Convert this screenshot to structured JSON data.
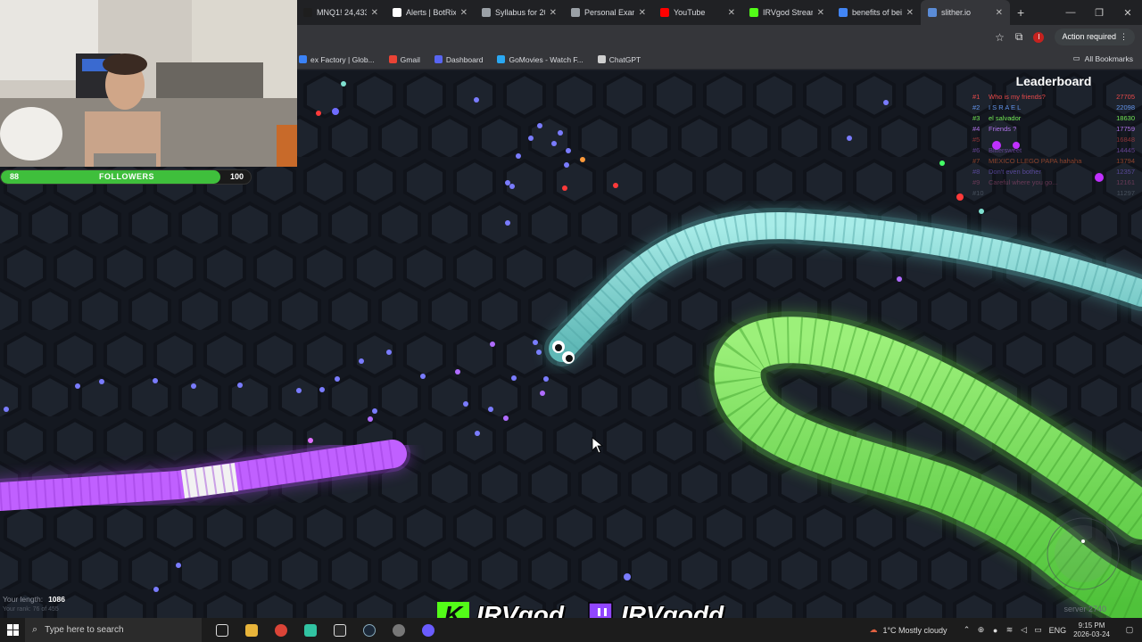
{
  "browser": {
    "tabs": [
      {
        "title": "MNQ1! 24,433",
        "color": "#1e1e1e"
      },
      {
        "title": "Alerts | BotRix",
        "color": "#ffffff"
      },
      {
        "title": "Syllabus for 20",
        "color": "#9aa0a6"
      },
      {
        "title": "Personal Exam",
        "color": "#9aa0a6"
      },
      {
        "title": "YouTube",
        "color": "#ff0000"
      },
      {
        "title": "IRVgod Stream",
        "color": "#53fc18"
      },
      {
        "title": "benefits of bei",
        "color": "#4285f4"
      },
      {
        "title": "slither.io",
        "color": "#5b8cd6",
        "active": true
      }
    ],
    "new_tab": "+",
    "action_required": "Action required",
    "bookmarks": [
      {
        "label": "ex Factory | Glob...",
        "color": "#3b82f6"
      },
      {
        "label": "Gmail",
        "color": "#ea4335"
      },
      {
        "label": "Dashboard",
        "color": "#5865f2"
      },
      {
        "label": "GoMovies - Watch F...",
        "color": "#2aa8f2"
      },
      {
        "label": "ChatGPT",
        "color": "#cfcfcf"
      }
    ],
    "all_bookmarks": "All Bookmarks"
  },
  "overlay": {
    "followers_label": "FOLLOWERS",
    "followers_current": "88",
    "followers_goal": "100",
    "followers_progress": 0.88
  },
  "game": {
    "leaderboard_title": "Leaderboard",
    "leaderboard": [
      {
        "rank": "#1",
        "name": "Who is my friends?",
        "score": "27705",
        "color": "#ff4e4e"
      },
      {
        "rank": "#2",
        "name": "I S R A E L",
        "score": "22098",
        "color": "#6aa0ff"
      },
      {
        "rank": "#3",
        "name": "el salvador",
        "score": "18630",
        "color": "#7dff5c"
      },
      {
        "rank": "#4",
        "name": "Friends ?",
        "score": "17759",
        "color": "#c07dff"
      },
      {
        "rank": "#5",
        "name": "",
        "score": "16848",
        "color": "#ff4e4e"
      },
      {
        "rank": "#6",
        "name": "Bittersweet",
        "score": "14445",
        "color": "#b06cff"
      },
      {
        "rank": "#7",
        "name": "MEXICO LLEGO PAPA hahaha",
        "score": "13794",
        "color": "#ff6e3a"
      },
      {
        "rank": "#8",
        "name": "Don't even bother",
        "score": "12357",
        "color": "#8f6cff"
      },
      {
        "rank": "#9",
        "name": "Careful where you go...",
        "score": "12161",
        "color": "#b0507f"
      },
      {
        "rank": "#10",
        "name": "",
        "score": "11297",
        "color": "#6f7b8a"
      }
    ],
    "your_length_label": "Your length:",
    "your_length": "1086",
    "your_rank": "Your rank: 76 of 455",
    "server": "server 2740"
  },
  "branding": {
    "kick_name": "IRVgod",
    "twitch_name": "IRVgodd"
  },
  "taskbar": {
    "search_placeholder": "Type here to search",
    "weather": "1°C  Mostly cloudy",
    "language": "ENG",
    "time": "9:15 PM",
    "date": "2026-03-24"
  }
}
